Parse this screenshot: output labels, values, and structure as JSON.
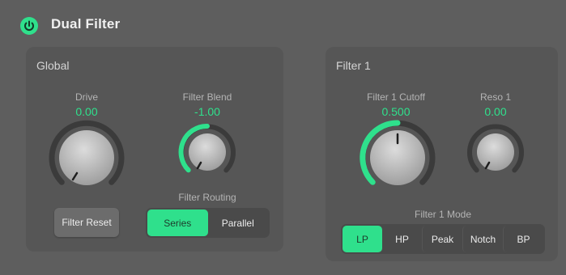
{
  "header": {
    "title": "Dual Filter",
    "power_on": true
  },
  "colors": {
    "accent": "#2fe08c",
    "background": "#5e5e5e",
    "panel": "#565656"
  },
  "global": {
    "title": "Global",
    "drive": {
      "label": "Drive",
      "value": "0.00"
    },
    "filter_blend": {
      "label": "Filter Blend",
      "value": "-1.00"
    },
    "filter_reset": {
      "label": "Filter Reset"
    },
    "routing": {
      "label": "Filter Routing",
      "options": [
        "Series",
        "Parallel"
      ],
      "selected": "Series"
    }
  },
  "filter1": {
    "title": "Filter 1",
    "cutoff": {
      "label": "Filter 1 Cutoff",
      "value": "0.500"
    },
    "reso": {
      "label": "Reso 1",
      "value": "0.00"
    },
    "mode": {
      "label": "Filter 1 Mode",
      "options": [
        "LP",
        "HP",
        "Peak",
        "Notch",
        "BP"
      ],
      "selected": "LP"
    }
  }
}
